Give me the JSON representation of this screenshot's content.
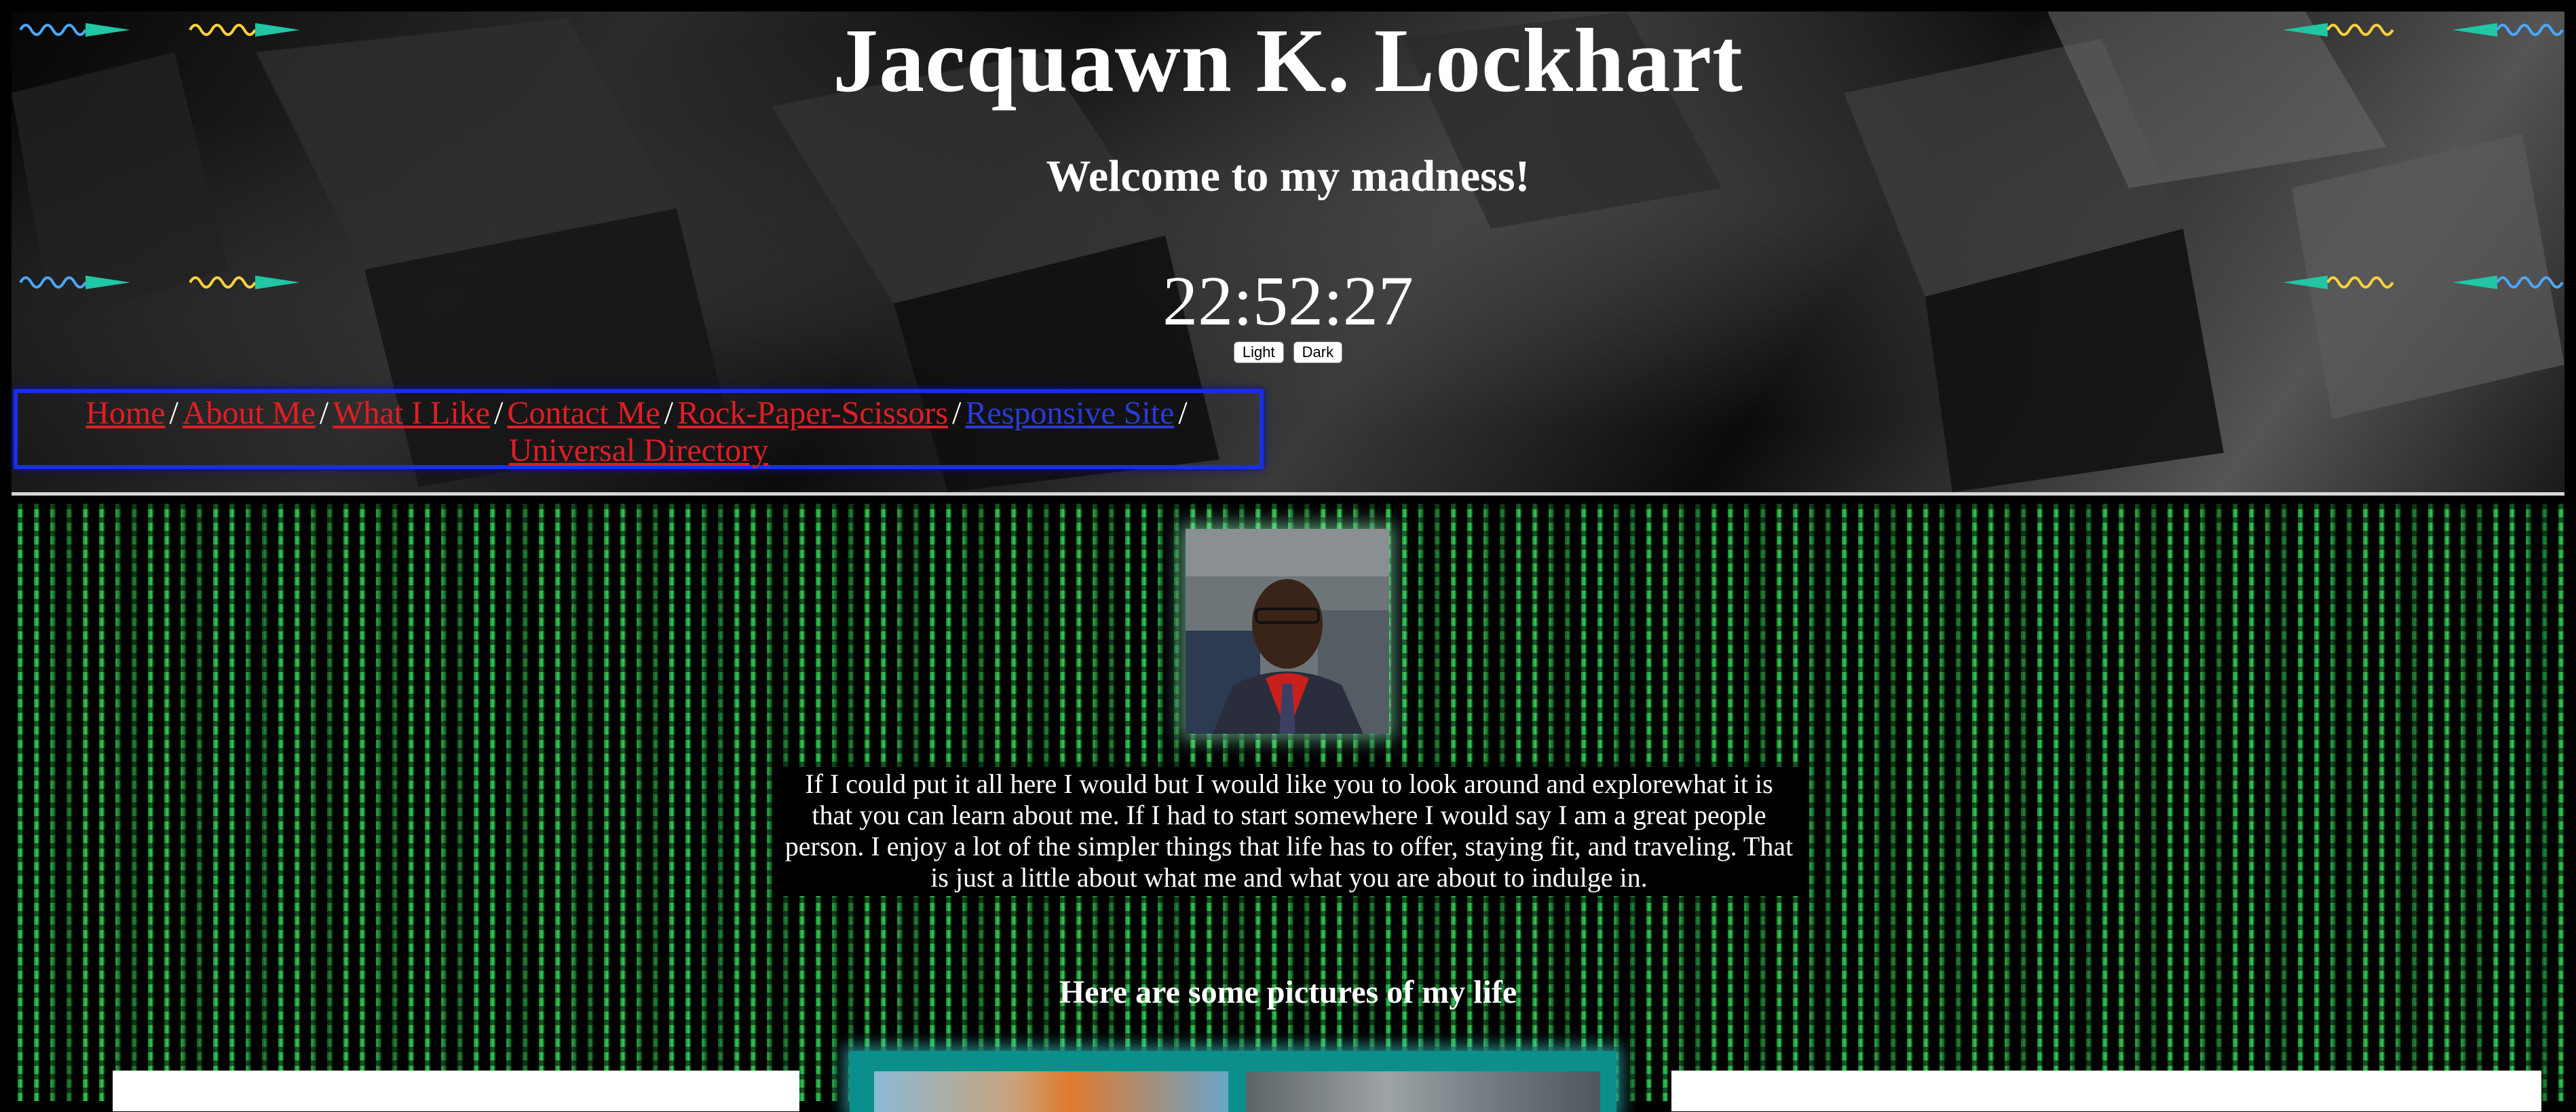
{
  "header": {
    "title": "Jacquawn K. Lockhart",
    "subtitle": "Welcome to my madness!",
    "clock": "22:52:27",
    "theme_buttons": {
      "light": "Light",
      "dark": "Dark"
    }
  },
  "nav": {
    "items": [
      {
        "label": "Home"
      },
      {
        "label": "About Me"
      },
      {
        "label": "What I Like"
      },
      {
        "label": "Contact Me"
      },
      {
        "label": "Rock-Paper-Scissors"
      },
      {
        "label": "Responsive Site"
      },
      {
        "label": "Universal Directory"
      }
    ],
    "separator": "/"
  },
  "main": {
    "intro": "If I could put it all here I would but I would like you to look around and explorewhat it is that you can learn about me. If I had to start somewhere I would say I am a great people person. I enjoy a lot of the simpler things that life has to offer, staying fit, and traveling. That is just a little about what me and what you are about to indulge in.",
    "pictures_heading": "Here are some pictures of my life"
  },
  "colors": {
    "link_red": "#e21d25",
    "link_visited_blue": "#2a3ad8",
    "nav_border": "#1a2ee8",
    "matrix_green": "#3ce65f",
    "gallery_teal": "#0a8f8c"
  }
}
